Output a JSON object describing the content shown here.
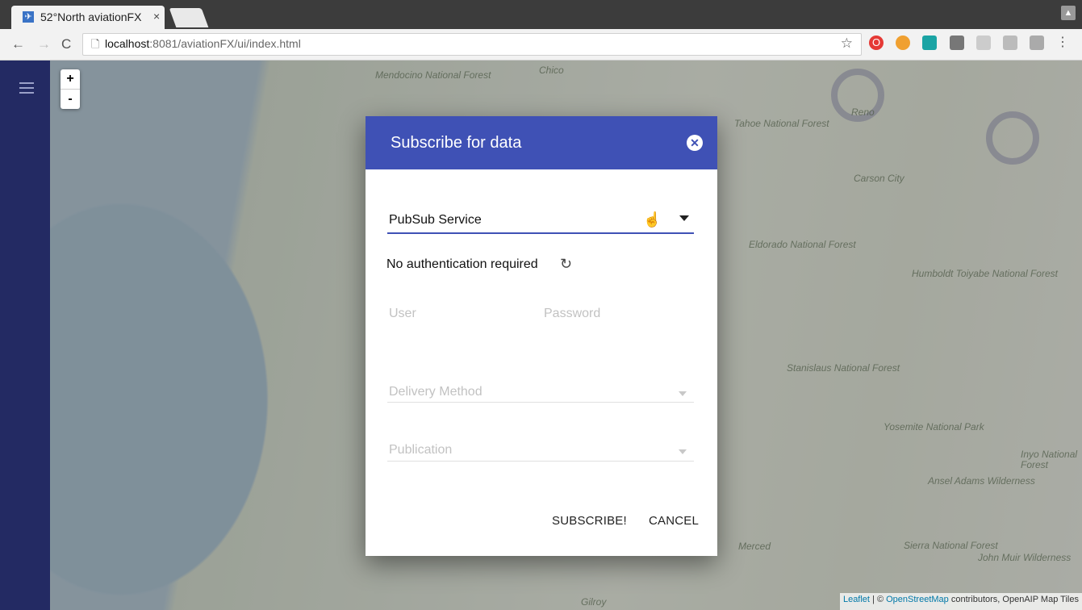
{
  "browser": {
    "tab_title": "52°North aviationFX",
    "tab_close": "×",
    "url_host": "localhost",
    "url_path": ":8081/aviationFX/ui/index.html",
    "nav_back": "←",
    "nav_forward": "→",
    "nav_reload": "C",
    "star": "☆"
  },
  "map": {
    "zoom_in": "+",
    "zoom_out": "-",
    "places": [
      "Mendocino National Forest",
      "Tahoe National Forest",
      "Eldorado National Forest",
      "Humboldt Toiyabe National Forest",
      "Stanislaus National Forest",
      "Yosemite National Park",
      "Sierra National Forest",
      "Inyo National Forest",
      "Ansel Adams Wilderness",
      "John Muir Wilderness",
      "Carson City",
      "Reno",
      "Merced",
      "Gilroy",
      "Chico"
    ],
    "attribution": {
      "leaflet": "Leaflet",
      "sep": " | © ",
      "osm": "OpenStreetMap",
      "rest": " contributors, OpenAIP Map Tiles"
    }
  },
  "dialog": {
    "title": "Subscribe for data",
    "close_glyph": "✕",
    "service_value": "PubSub Service",
    "auth_status": "No authentication required",
    "user_placeholder": "User",
    "password_placeholder": "Password",
    "delivery_placeholder": "Delivery Method",
    "publication_placeholder": "Publication",
    "subscribe_label": "SUBSCRIBE!",
    "cancel_label": "CANCEL"
  },
  "colors": {
    "primary": "#3f51b5",
    "sidebar": "#232a63"
  }
}
